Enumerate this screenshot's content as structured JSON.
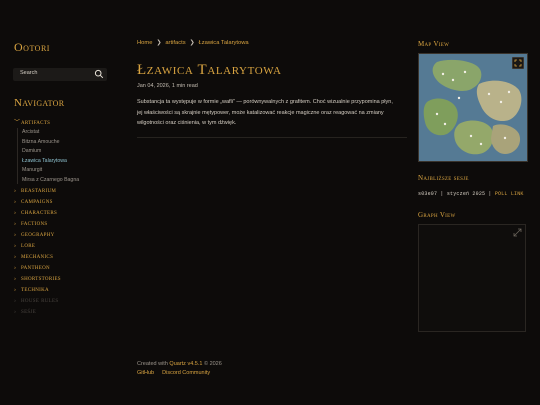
{
  "site": {
    "title": "Ootori"
  },
  "search": {
    "placeholder": "Search"
  },
  "navigator": {
    "title": "Navigator",
    "folders": [
      {
        "label": "artifacts",
        "items": [
          "Arcistat",
          "Bitzna Amouche",
          "Damium",
          "Łzawica Talarytowa",
          "Manurgit",
          "Mirsa z Czarnego Bagna"
        ]
      },
      {
        "label": "beastarium"
      },
      {
        "label": "campaigns"
      },
      {
        "label": "characters"
      },
      {
        "label": "factions"
      },
      {
        "label": "geography"
      },
      {
        "label": "lore"
      },
      {
        "label": "mechanics"
      },
      {
        "label": "pantheon"
      },
      {
        "label": "shortstories"
      },
      {
        "label": "technika"
      },
      {
        "label": "house rules"
      },
      {
        "label": "seśje"
      }
    ]
  },
  "breadcrumb": {
    "home": "Home",
    "sep": "❯",
    "folder": "artifacts",
    "current": "Łzawica Talarytowa"
  },
  "page": {
    "title": "Łzawica Talarytowa",
    "meta": "Jan 04, 2026, 1 min read",
    "body": "Substancja ta występuje w formie „wafli” — porównywalnych z grafitem. Choć wizualnie przypomina płyn, jej właściwości są skrajnie mętypower, może katalizować reakcje magiczne oraz reagować na zmiany wilgotności oraz ciśnienia, w tym dźwięk."
  },
  "footer": {
    "created_prefix": "Created with",
    "quartz": "Quartz v4.5.1",
    "created_suffix": "© 2026",
    "links": [
      "GitHub",
      "Discord Community"
    ]
  },
  "right": {
    "map_title": "Map View",
    "session_title": "Najbliższe sesje",
    "session_id": "s03e07",
    "session_sep": "|",
    "session_date": "styczeń 2025",
    "session_poll": "POLL LINK",
    "graph_title": "Graph View"
  },
  "colors": {
    "accent": "#d9a441",
    "background": "#0d0b0a",
    "active_link": "#8ec2cf"
  }
}
